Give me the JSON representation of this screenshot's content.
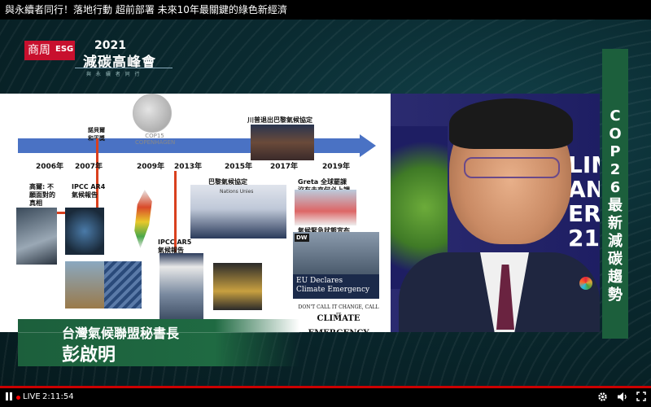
{
  "window": {
    "title": "與永續者同行！落地行動 超前部署 未來10年最關鍵的綠色新經濟"
  },
  "logo": {
    "brand": "商周",
    "esg": "ESG",
    "year": "2021",
    "title": "減碳高峰會",
    "subtitle": "與 永 續 者 同 行"
  },
  "slide": {
    "years": [
      "2006年",
      "2007年",
      "2009年",
      "2013年",
      "2015年",
      "2017年",
      "2019年"
    ],
    "labels": {
      "nobel": "諾貝爾\n和平獎",
      "gore": "高爾: 不\n願面對的\n真相",
      "ar4": "IPCC AR4\n氣候報告",
      "cop15_line1": "COP15",
      "cop15_line2": "COPENHAGEN",
      "trump": "川普退出巴黎氣候協定",
      "paris": "巴黎氣候協定",
      "ar5": "IPCC AR5\n氣候報告",
      "greta": "Greta 全球罷課\n沒有未來何必上課",
      "emergency": "氣候緊急狀態宣布",
      "eu_declares": "EU Declares\nClimate Emergency",
      "dont_call": "DON'T CALL IT CHANGE, CALL IT",
      "climate_emergency": "CLIMATE EMERGENCY",
      "un_banner": "Nations Unies",
      "dw": "DW"
    }
  },
  "video": {
    "backdrop_letters": [
      "LIMA",
      "ANGE",
      "ERE",
      "21"
    ]
  },
  "sidebar": {
    "chars": [
      "C",
      "O",
      "P",
      "2",
      "6",
      "最",
      "新",
      "減",
      "碳",
      "趨",
      "勢"
    ]
  },
  "lower_third": {
    "role": "台灣氣候聯盟秘書長",
    "name": "彭啟明"
  },
  "player": {
    "live": "LIVE",
    "time": "2:11:54",
    "icons": [
      "pause-icon",
      "gear-icon",
      "volume-icon",
      "fullscreen-icon"
    ]
  }
}
